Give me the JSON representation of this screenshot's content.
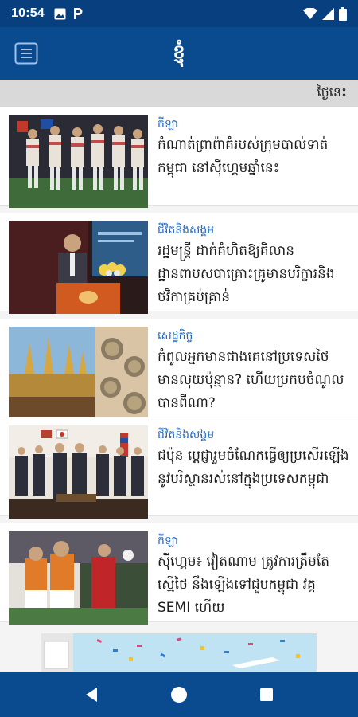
{
  "status_bar": {
    "time": "10:54",
    "left_icons": [
      "image-icon",
      "parking-icon"
    ],
    "right_icons": [
      "wifi-icon",
      "signal-icon",
      "battery-icon"
    ]
  },
  "app_bar": {
    "title": "ខ្ញុំ",
    "menu_icon": "menu-icon"
  },
  "date_strip": {
    "label": "ថ្ងៃនេះ"
  },
  "articles": [
    {
      "category": "កីឡា",
      "headline": "កំណាត់ព្រាព៉ាគំរបស់ក្រុមបាល់ទាត់កម្ពុជា នៅស៊ីហ្គេមឆ្នាំនេះ",
      "image": "football-team-photo"
    },
    {
      "category": "ជីវិតនិងសង្គម",
      "headline": "រដ្ឋមន្ត្រី ដាក់គំហិតឱ្យគិលានដ្ឋានពាបសបាគ្រោះគ្រូមានបរិក្ខារនិងថវិកាគ្រប់គ្រាន់",
      "image": "minister-podium-photo"
    },
    {
      "category": "សេដ្ឋកិច្ច",
      "headline": "កំពូលអ្នកមានជាងគេនៅប្រទេសថៃ មានលុយប៉ុន្មាន? ហើយប្រកបចំណូលបានពីណា?",
      "image": "thai-temple-coins-photo"
    },
    {
      "category": "ជីវិតនិងសង្គម",
      "headline": "ជប៉ុន ប្តេជ្ញារួមចំណែកធ្វើឲ្យប្រសើរឡើងនូវបរិស្ថានរស់នៅក្នុងប្រទេសកម្ពុជា",
      "image": "signing-ceremony-photo"
    },
    {
      "category": "កីឡា",
      "headline": "ស៊ីហ្គេម៖ វៀតណាម ត្រូវការត្រឹមតែស្មើថៃ នឹងឡើងទៅជួបកម្ពុជា វគ្គ SEMI ហើយ",
      "image": "football-match-photo"
    }
  ],
  "ad_banner": {
    "image": "promo-banner"
  },
  "nav_bar": {
    "items": [
      "back-button",
      "home-button",
      "recents-button"
    ]
  },
  "colors": {
    "status_bar": "#08407f",
    "app_bar": "#0a4a8f",
    "category": "#1a66c9",
    "date_strip": "#d9d9d9"
  }
}
